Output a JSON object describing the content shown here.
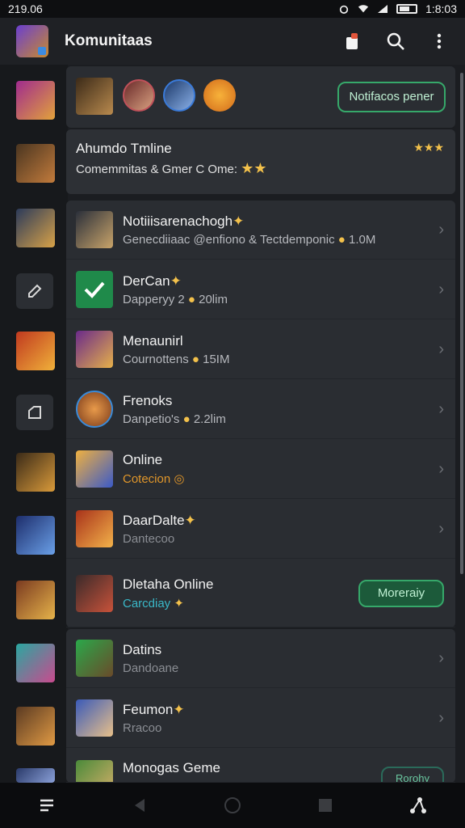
{
  "status": {
    "left_time": "219.06",
    "right_time": "1:8:03"
  },
  "app": {
    "title": "Komunitaas"
  },
  "top_card": {
    "button": "Notifacos pener"
  },
  "feature_card": {
    "title": "Ahumdo Tmline",
    "subtitle": "Comemmitas & Gmer C Ome:",
    "rating": "★★★"
  },
  "rows": [
    {
      "title": "Notiiisarenachogh",
      "sub": "Genecdiiaac @enfiono & Tectdemponic",
      "count": "1.0M"
    },
    {
      "title": "DerCan",
      "sub": "Dapperyy 2",
      "count": "20lim"
    },
    {
      "title": "Menaunirl",
      "sub": "Cournottens",
      "count": "15IM"
    },
    {
      "title": "Frenoks",
      "sub": "Danpetio's",
      "count": "2.2lim"
    },
    {
      "title": "Online",
      "sub": "Cotecion"
    },
    {
      "title": "DaarDalte",
      "sub": "Dantecoo"
    },
    {
      "title": "Dletaha Online",
      "sub": "Carcdiay",
      "button": "Moreraiy"
    },
    {
      "title": "Datins",
      "sub": "Dandoane"
    },
    {
      "title": "Feumon",
      "sub": "Rracoo"
    },
    {
      "title": "Monogas Geme",
      "sub": "",
      "button": "Rorohy"
    }
  ],
  "colors": {
    "accent": "#36a86a",
    "star": "#f3c14b",
    "card": "#2a2d32",
    "background": "#1b1d21"
  },
  "icons": [
    "wifi-icon",
    "signal-icon",
    "battery-icon",
    "alarm-icon",
    "notification-icon",
    "search-icon",
    "more-icon",
    "edit-icon",
    "folder-icon",
    "back-icon",
    "home-icon",
    "recents-icon",
    "menu-icon",
    "share-icon"
  ]
}
